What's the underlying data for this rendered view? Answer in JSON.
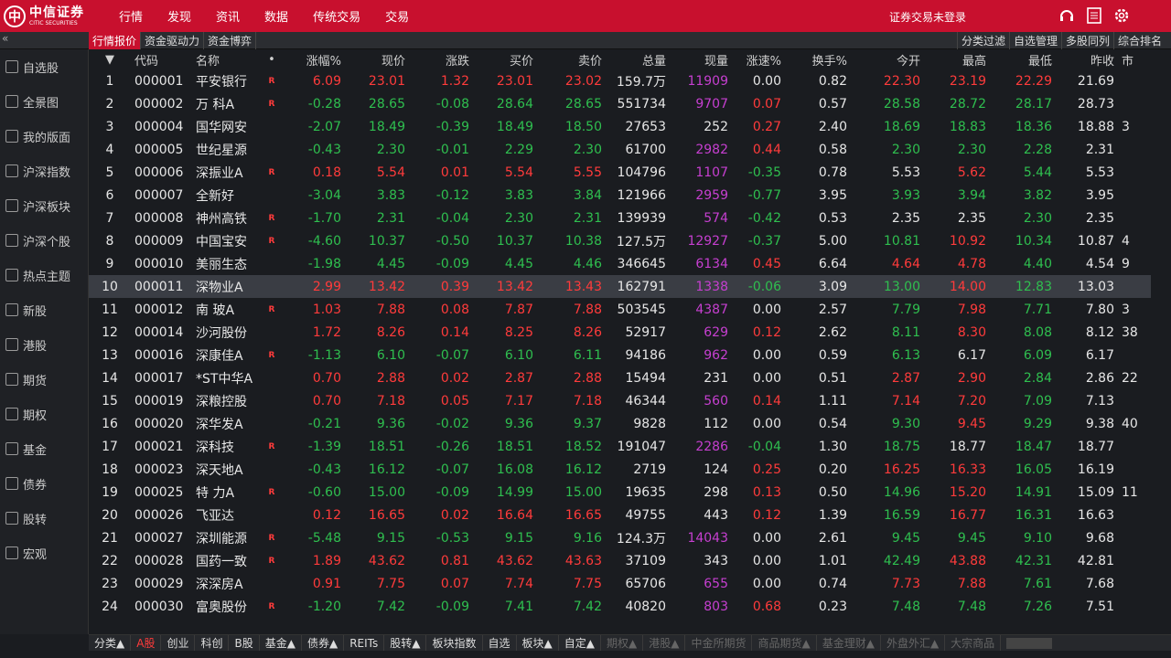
{
  "brand": {
    "cn": "中信证券",
    "en": "CITIC SECURITIES"
  },
  "menu": [
    "行情",
    "发现",
    "资讯",
    "数据",
    "传统交易",
    "交易"
  ],
  "login_status": "证券交易未登录",
  "top_icons": [
    "headset-icon",
    "notes-icon",
    "settings-icon"
  ],
  "sub_tabs": [
    "行情报价",
    "资金驱动力",
    "资金博弈"
  ],
  "right_buttons": [
    "分类过滤",
    "自选管理",
    "多股同列",
    "综合排名"
  ],
  "sidebar": [
    "自选股",
    "全景图",
    "我的版面",
    "沪深指数",
    "沪深板块",
    "沪深个股",
    "热点主题",
    "新股",
    "港股",
    "期货",
    "期权",
    "基金",
    "债券",
    "股转",
    "宏观"
  ],
  "columns": [
    "",
    "代码",
    "名称",
    "•",
    "涨幅%",
    "现价",
    "涨跌",
    "买价",
    "卖价",
    "总量",
    "现量",
    "涨速%",
    "换手%",
    "今开",
    "最高",
    "最低",
    "昨收",
    "市"
  ],
  "rows": [
    {
      "n": "1",
      "code": "000001",
      "name": "平安银行",
      "flag": "R",
      "pct": "6.09",
      "price": "23.01",
      "chg": "1.32",
      "bid": "23.01",
      "ask": "23.02",
      "vol": "159.7万",
      "cur": "11909",
      "spd": "0.00",
      "turn": "0.82",
      "open": "22.30",
      "high": "23.19",
      "low": "22.29",
      "prev": "21.69",
      "mkt": ""
    },
    {
      "n": "2",
      "code": "000002",
      "name": "万 科A",
      "flag": "R",
      "pct": "-0.28",
      "price": "28.65",
      "chg": "-0.08",
      "bid": "28.64",
      "ask": "28.65",
      "vol": "551734",
      "cur": "9707",
      "spd": "0.07",
      "turn": "0.57",
      "open": "28.58",
      "high": "28.72",
      "low": "28.17",
      "prev": "28.73",
      "mkt": ""
    },
    {
      "n": "3",
      "code": "000004",
      "name": "国华网安",
      "flag": "",
      "pct": "-2.07",
      "price": "18.49",
      "chg": "-0.39",
      "bid": "18.49",
      "ask": "18.50",
      "vol": "27653",
      "cur": "252",
      "spd": "0.27",
      "turn": "2.40",
      "open": "18.69",
      "high": "18.83",
      "low": "18.36",
      "prev": "18.88",
      "mkt": "3"
    },
    {
      "n": "4",
      "code": "000005",
      "name": "世纪星源",
      "flag": "",
      "pct": "-0.43",
      "price": "2.30",
      "chg": "-0.01",
      "bid": "2.29",
      "ask": "2.30",
      "vol": "61700",
      "cur": "2982",
      "spd": "0.44",
      "turn": "0.58",
      "open": "2.30",
      "high": "2.30",
      "low": "2.28",
      "prev": "2.31",
      "mkt": ""
    },
    {
      "n": "5",
      "code": "000006",
      "name": "深振业A",
      "flag": "R",
      "pct": "0.18",
      "price": "5.54",
      "chg": "0.01",
      "bid": "5.54",
      "ask": "5.55",
      "vol": "104796",
      "cur": "1107",
      "spd": "-0.35",
      "turn": "0.78",
      "open": "5.53",
      "high": "5.62",
      "low": "5.44",
      "prev": "5.53",
      "mkt": ""
    },
    {
      "n": "6",
      "code": "000007",
      "name": "全新好",
      "flag": "",
      "pct": "-3.04",
      "price": "3.83",
      "chg": "-0.12",
      "bid": "3.83",
      "ask": "3.84",
      "vol": "121966",
      "cur": "2959",
      "spd": "-0.77",
      "turn": "3.95",
      "open": "3.93",
      "high": "3.94",
      "low": "3.82",
      "prev": "3.95",
      "mkt": ""
    },
    {
      "n": "7",
      "code": "000008",
      "name": "神州高铁",
      "flag": "R",
      "pct": "-1.70",
      "price": "2.31",
      "chg": "-0.04",
      "bid": "2.30",
      "ask": "2.31",
      "vol": "139939",
      "cur": "574",
      "spd": "-0.42",
      "turn": "0.53",
      "open": "2.35",
      "high": "2.35",
      "low": "2.30",
      "prev": "2.35",
      "mkt": ""
    },
    {
      "n": "8",
      "code": "000009",
      "name": "中国宝安",
      "flag": "R",
      "pct": "-4.60",
      "price": "10.37",
      "chg": "-0.50",
      "bid": "10.37",
      "ask": "10.38",
      "vol": "127.5万",
      "cur": "12927",
      "spd": "-0.37",
      "turn": "5.00",
      "open": "10.81",
      "high": "10.92",
      "low": "10.34",
      "prev": "10.87",
      "mkt": "4"
    },
    {
      "n": "9",
      "code": "000010",
      "name": "美丽生态",
      "flag": "",
      "pct": "-1.98",
      "price": "4.45",
      "chg": "-0.09",
      "bid": "4.45",
      "ask": "4.46",
      "vol": "346645",
      "cur": "6134",
      "spd": "0.45",
      "turn": "6.64",
      "open": "4.64",
      "high": "4.78",
      "low": "4.40",
      "prev": "4.54",
      "mkt": "9"
    },
    {
      "n": "10",
      "code": "000011",
      "name": "深物业A",
      "flag": "",
      "pct": "2.99",
      "price": "13.42",
      "chg": "0.39",
      "bid": "13.42",
      "ask": "13.43",
      "vol": "162791",
      "cur": "1338",
      "spd": "-0.06",
      "turn": "3.09",
      "open": "13.00",
      "high": "14.00",
      "low": "12.83",
      "prev": "13.03",
      "mkt": ""
    },
    {
      "n": "11",
      "code": "000012",
      "name": "南 玻A",
      "flag": "R",
      "pct": "1.03",
      "price": "7.88",
      "chg": "0.08",
      "bid": "7.87",
      "ask": "7.88",
      "vol": "503545",
      "cur": "4387",
      "spd": "0.00",
      "turn": "2.57",
      "open": "7.79",
      "high": "7.98",
      "low": "7.71",
      "prev": "7.80",
      "mkt": "3"
    },
    {
      "n": "12",
      "code": "000014",
      "name": "沙河股份",
      "flag": "",
      "pct": "1.72",
      "price": "8.26",
      "chg": "0.14",
      "bid": "8.25",
      "ask": "8.26",
      "vol": "52917",
      "cur": "629",
      "spd": "0.12",
      "turn": "2.62",
      "open": "8.11",
      "high": "8.30",
      "low": "8.08",
      "prev": "8.12",
      "mkt": "38"
    },
    {
      "n": "13",
      "code": "000016",
      "name": "深康佳A",
      "flag": "R",
      "pct": "-1.13",
      "price": "6.10",
      "chg": "-0.07",
      "bid": "6.10",
      "ask": "6.11",
      "vol": "94186",
      "cur": "962",
      "spd": "0.00",
      "turn": "0.59",
      "open": "6.13",
      "high": "6.17",
      "low": "6.09",
      "prev": "6.17",
      "mkt": ""
    },
    {
      "n": "14",
      "code": "000017",
      "name": "*ST中华A",
      "flag": "",
      "pct": "0.70",
      "price": "2.88",
      "chg": "0.02",
      "bid": "2.87",
      "ask": "2.88",
      "vol": "15494",
      "cur": "231",
      "spd": "0.00",
      "turn": "0.51",
      "open": "2.87",
      "high": "2.90",
      "low": "2.84",
      "prev": "2.86",
      "mkt": "22"
    },
    {
      "n": "15",
      "code": "000019",
      "name": "深粮控股",
      "flag": "",
      "pct": "0.70",
      "price": "7.18",
      "chg": "0.05",
      "bid": "7.17",
      "ask": "7.18",
      "vol": "46344",
      "cur": "560",
      "spd": "0.14",
      "turn": "1.11",
      "open": "7.14",
      "high": "7.20",
      "low": "7.09",
      "prev": "7.13",
      "mkt": ""
    },
    {
      "n": "16",
      "code": "000020",
      "name": "深华发A",
      "flag": "",
      "pct": "-0.21",
      "price": "9.36",
      "chg": "-0.02",
      "bid": "9.36",
      "ask": "9.37",
      "vol": "9828",
      "cur": "112",
      "spd": "0.00",
      "turn": "0.54",
      "open": "9.30",
      "high": "9.45",
      "low": "9.29",
      "prev": "9.38",
      "mkt": "40"
    },
    {
      "n": "17",
      "code": "000021",
      "name": "深科技",
      "flag": "R",
      "pct": "-1.39",
      "price": "18.51",
      "chg": "-0.26",
      "bid": "18.51",
      "ask": "18.52",
      "vol": "191047",
      "cur": "2286",
      "spd": "-0.04",
      "turn": "1.30",
      "open": "18.75",
      "high": "18.77",
      "low": "18.47",
      "prev": "18.77",
      "mkt": ""
    },
    {
      "n": "18",
      "code": "000023",
      "name": "深天地A",
      "flag": "",
      "pct": "-0.43",
      "price": "16.12",
      "chg": "-0.07",
      "bid": "16.08",
      "ask": "16.12",
      "vol": "2719",
      "cur": "124",
      "spd": "0.25",
      "turn": "0.20",
      "open": "16.25",
      "high": "16.33",
      "low": "16.05",
      "prev": "16.19",
      "mkt": ""
    },
    {
      "n": "19",
      "code": "000025",
      "name": "特 力A",
      "flag": "R",
      "pct": "-0.60",
      "price": "15.00",
      "chg": "-0.09",
      "bid": "14.99",
      "ask": "15.00",
      "vol": "19635",
      "cur": "298",
      "spd": "0.13",
      "turn": "0.50",
      "open": "14.96",
      "high": "15.20",
      "low": "14.91",
      "prev": "15.09",
      "mkt": "11"
    },
    {
      "n": "20",
      "code": "000026",
      "name": "飞亚达",
      "flag": "",
      "pct": "0.12",
      "price": "16.65",
      "chg": "0.02",
      "bid": "16.64",
      "ask": "16.65",
      "vol": "49755",
      "cur": "443",
      "spd": "0.12",
      "turn": "1.39",
      "open": "16.59",
      "high": "16.77",
      "low": "16.31",
      "prev": "16.63",
      "mkt": ""
    },
    {
      "n": "21",
      "code": "000027",
      "name": "深圳能源",
      "flag": "R",
      "pct": "-5.48",
      "price": "9.15",
      "chg": "-0.53",
      "bid": "9.15",
      "ask": "9.16",
      "vol": "124.3万",
      "cur": "14043",
      "spd": "0.00",
      "turn": "2.61",
      "open": "9.45",
      "high": "9.45",
      "low": "9.10",
      "prev": "9.68",
      "mkt": ""
    },
    {
      "n": "22",
      "code": "000028",
      "name": "国药一致",
      "flag": "R",
      "pct": "1.89",
      "price": "43.62",
      "chg": "0.81",
      "bid": "43.62",
      "ask": "43.63",
      "vol": "37109",
      "cur": "343",
      "spd": "0.00",
      "turn": "1.01",
      "open": "42.49",
      "high": "43.88",
      "low": "42.31",
      "prev": "42.81",
      "mkt": ""
    },
    {
      "n": "23",
      "code": "000029",
      "name": "深深房A",
      "flag": "",
      "pct": "0.91",
      "price": "7.75",
      "chg": "0.07",
      "bid": "7.74",
      "ask": "7.75",
      "vol": "65706",
      "cur": "655",
      "spd": "0.00",
      "turn": "0.74",
      "open": "7.73",
      "high": "7.88",
      "low": "7.61",
      "prev": "7.68",
      "mkt": ""
    },
    {
      "n": "24",
      "code": "000030",
      "name": "富奥股份",
      "flag": "R",
      "pct": "-1.20",
      "price": "7.42",
      "chg": "-0.09",
      "bid": "7.41",
      "ask": "7.42",
      "vol": "40820",
      "cur": "803",
      "spd": "0.68",
      "turn": "0.23",
      "open": "7.48",
      "high": "7.48",
      "low": "7.26",
      "prev": "7.51",
      "mkt": ""
    }
  ],
  "bottom_tabs": [
    "分类▲",
    "A股",
    "创业",
    "科创",
    "B股",
    "基金▲",
    "债券▲",
    "REITs",
    "股转▲",
    "板块指数",
    "自选",
    "板块▲",
    "自定▲",
    "期权▲",
    "港股▲",
    "中金所期货",
    "商品期货▲",
    "基金理财▲",
    "外盘外汇▲",
    "大宗商品"
  ],
  "colors": {
    "brand": "#c8102e",
    "up": "#ff3b3b",
    "down": "#2fbf4f",
    "volume": "#c63fd0"
  }
}
